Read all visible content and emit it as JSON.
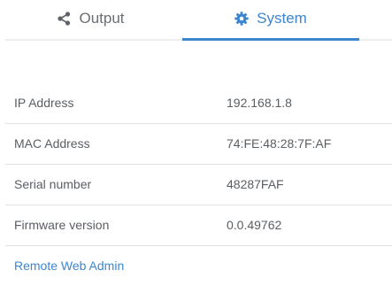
{
  "tabs": [
    {
      "label": "Output",
      "icon": "share-icon",
      "active": false
    },
    {
      "label": "System",
      "icon": "gear-icon",
      "active": true
    }
  ],
  "info": [
    {
      "label": "IP Address",
      "value": "192.168.1.8"
    },
    {
      "label": "MAC Address",
      "value": "74:FE:48:28:7F:AF"
    },
    {
      "label": "Serial number",
      "value": "48287FAF"
    },
    {
      "label": "Firmware version",
      "value": "0.0.49762"
    }
  ],
  "link": {
    "label": "Remote Web Admin"
  },
  "colors": {
    "accent": "#3c86d0",
    "text": "#5a5e63",
    "divider": "#e2e2e2"
  }
}
